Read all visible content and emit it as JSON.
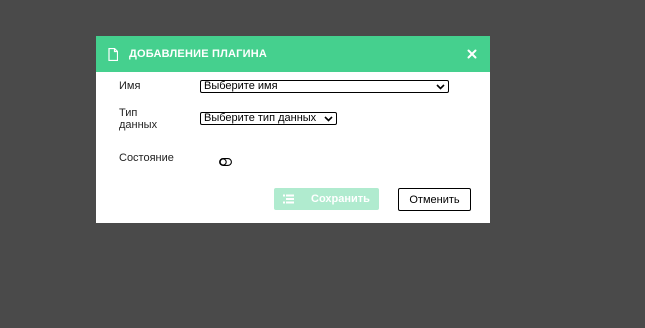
{
  "dialog": {
    "title": "ДОБАВЛЕНИЕ ПЛАГИНА",
    "header_icon": "document-icon",
    "close_icon": "close-icon"
  },
  "form": {
    "name_label": "Имя",
    "name_select_value": "Выберите имя",
    "type_label_line1": "Тип",
    "type_label_line2": "данных",
    "type_select_value": "Выберите тип данных",
    "state_label": "Состояние"
  },
  "buttons": {
    "save_label": "Сохранить",
    "save_icon": "list-icon",
    "cancel_label": "Отменить"
  },
  "colors": {
    "header_bg": "#45d08e",
    "save_bg": "#b0ebcf",
    "backdrop": "#4a4a4a"
  }
}
